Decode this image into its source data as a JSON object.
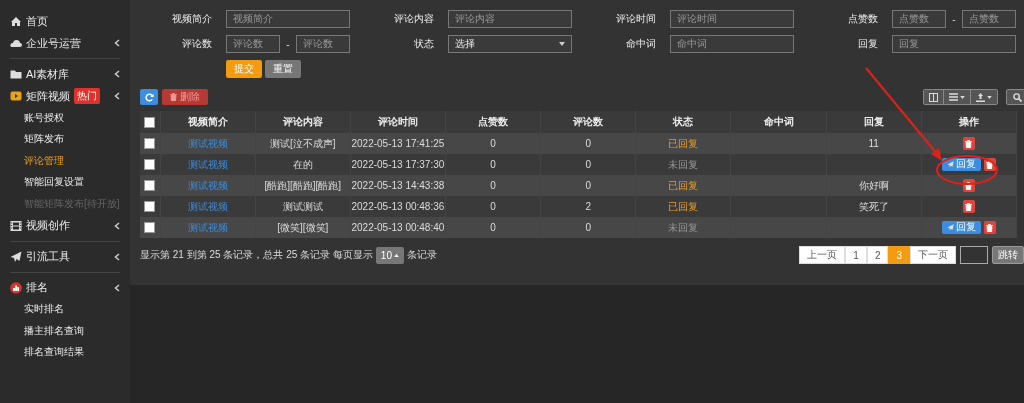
{
  "sidebar": {
    "groups": [
      [
        {
          "label": "首页",
          "expandable": false
        },
        {
          "label": "企业号运营",
          "expandable": true
        }
      ],
      [
        {
          "label": "AI素材库",
          "expandable": true
        },
        {
          "label": "矩阵视频",
          "badge": "热门",
          "expandable": true,
          "children": [
            {
              "label": "账号授权",
              "selected": false,
              "disabled": false
            },
            {
              "label": "矩阵发布",
              "selected": false,
              "disabled": false
            },
            {
              "label": "评论管理",
              "selected": true,
              "disabled": false
            },
            {
              "label": "智能回复设置",
              "selected": false,
              "disabled": false
            },
            {
              "label": "智能矩阵发布[待开放]",
              "selected": false,
              "disabled": true
            }
          ]
        },
        {
          "label": "视频创作",
          "expandable": true
        }
      ],
      [
        {
          "label": "引流工具",
          "expandable": true
        }
      ],
      [
        {
          "label": "排名",
          "expandable": true,
          "children": [
            {
              "label": "实时排名",
              "selected": false,
              "disabled": false
            },
            {
              "label": "播主排名查询",
              "selected": false,
              "disabled": false
            },
            {
              "label": "排名查询结果",
              "selected": false,
              "disabled": false
            }
          ]
        }
      ]
    ]
  },
  "filters": [
    {
      "label": "视频简介",
      "kind": "text",
      "placeholder": "视频简介"
    },
    {
      "label": "评论内容",
      "kind": "text",
      "placeholder": "评论内容"
    },
    {
      "label": "评论时间",
      "kind": "text",
      "placeholder": "评论时间"
    },
    {
      "label": "点赞数",
      "kind": "range",
      "placeholders": [
        "点赞数",
        "点赞数"
      ],
      "separator": "-"
    },
    {
      "label": "评论数",
      "kind": "range",
      "placeholders": [
        "评论数",
        "评论数"
      ],
      "separator": "-"
    },
    {
      "label": "状态",
      "kind": "select",
      "value": "选择"
    },
    {
      "label": "命中词",
      "kind": "text",
      "placeholder": "命中词"
    },
    {
      "label": "回复",
      "kind": "text",
      "placeholder": "回复"
    }
  ],
  "form_buttons": [
    {
      "label": "提交",
      "kind": "primary"
    },
    {
      "label": "重置",
      "kind": "secondary"
    }
  ],
  "toolbar": {
    "delete_label": "删除"
  },
  "table": {
    "all_checked": false,
    "columns": [
      "视频简介",
      "评论内容",
      "评论时间",
      "点赞数",
      "评论数",
      "状态",
      "命中词",
      "回复",
      "操作"
    ],
    "rows": [
      {
        "checked": false,
        "video": "测试视频",
        "comment": "测试[泣不成声]",
        "time": "2022-05-13 17:41:25",
        "likes": "0",
        "comments": "0",
        "status": {
          "label": "已回复",
          "kind": "replied"
        },
        "hit_word": "",
        "reply": "11",
        "actions": [
          {
            "kind": "delete"
          }
        ]
      },
      {
        "checked": false,
        "video": "测试视频",
        "comment": "在的",
        "time": "2022-05-13 17:37:30",
        "likes": "0",
        "comments": "0",
        "status": {
          "label": "未回复",
          "kind": "unreplied"
        },
        "hit_word": "",
        "reply": "",
        "actions": [
          {
            "kind": "reply",
            "label": "回复"
          },
          {
            "kind": "delete"
          }
        ]
      },
      {
        "checked": false,
        "video": "测试视频",
        "comment": "[酷跑][酷跑][酷跑]",
        "time": "2022-05-13 14:43:38",
        "likes": "0",
        "comments": "0",
        "status": {
          "label": "已回复",
          "kind": "replied"
        },
        "hit_word": "",
        "reply": "你好啊",
        "actions": [
          {
            "kind": "delete"
          }
        ]
      },
      {
        "checked": false,
        "video": "测试视频",
        "comment": "测试测试",
        "time": "2022-05-13 00:48:36",
        "likes": "0",
        "comments": "2",
        "status": {
          "label": "已回复",
          "kind": "replied"
        },
        "hit_word": "",
        "reply": "笑死了",
        "actions": [
          {
            "kind": "delete"
          }
        ]
      },
      {
        "checked": false,
        "video": "测试视频",
        "comment": "[微笑][微笑]",
        "time": "2022-05-13 00:48:40",
        "likes": "0",
        "comments": "0",
        "status": {
          "label": "未回复",
          "kind": "unreplied"
        },
        "hit_word": "",
        "reply": "",
        "actions": [
          {
            "kind": "reply",
            "label": "回复"
          },
          {
            "kind": "delete"
          }
        ]
      }
    ]
  },
  "pagination": {
    "summary": "显示第 21 到第 25 条记录，总共 25 条记录 每页显示",
    "page_size": "10",
    "suffix": "条记录",
    "pages": [
      {
        "label": "上一页",
        "selected": false
      },
      {
        "label": "1",
        "selected": false
      },
      {
        "label": "2",
        "selected": false
      },
      {
        "label": "3",
        "selected": true
      },
      {
        "label": "下一页",
        "selected": false
      }
    ],
    "jump_label": "跳转"
  }
}
